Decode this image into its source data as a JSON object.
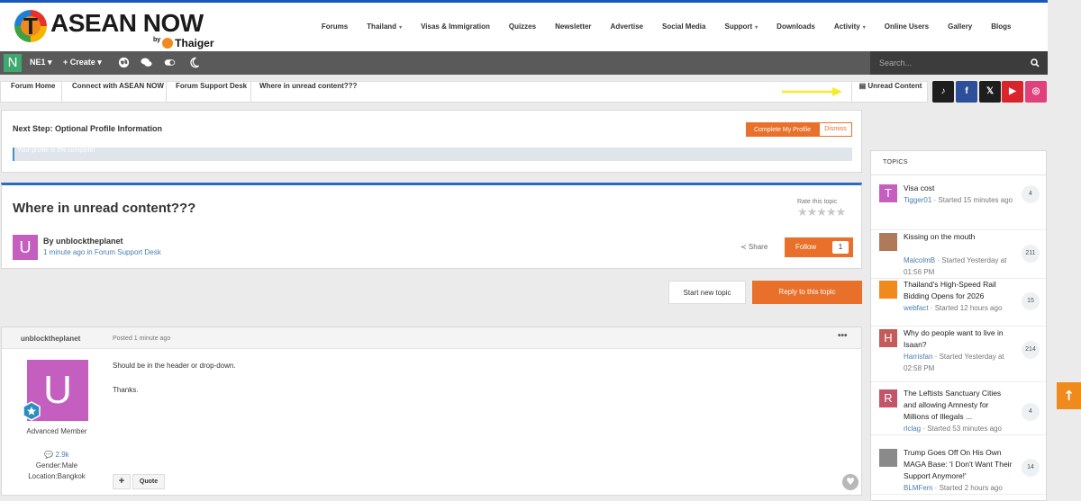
{
  "header": {
    "logo_text": "ASEAN NOW",
    "logo_by": "by",
    "logo_sub": "Thaiger",
    "nav": [
      {
        "label": "Forums",
        "caret": ""
      },
      {
        "label": "Thailand",
        "caret": "▾"
      },
      {
        "label": "Visas & Immigration",
        "caret": ""
      },
      {
        "label": "Quizzes",
        "caret": ""
      },
      {
        "label": "Newsletter",
        "caret": ""
      },
      {
        "label": "Advertise",
        "caret": ""
      },
      {
        "label": "Social Media",
        "caret": ""
      },
      {
        "label": "Support",
        "caret": "▾"
      },
      {
        "label": "Downloads",
        "caret": ""
      },
      {
        "label": "Activity",
        "caret": "▾"
      },
      {
        "label": "Online Users",
        "caret": ""
      },
      {
        "label": "Gallery",
        "caret": ""
      },
      {
        "label": "Blogs",
        "caret": ""
      }
    ]
  },
  "user_bar": {
    "avatar_letter": "N",
    "user_menu": "NE1 ▾",
    "create": "+ Create ▾",
    "search_placeholder": "Search..."
  },
  "breadcrumb": {
    "items": [
      "Forum Home",
      "Connect with ASEAN NOW",
      "Forum Support Desk",
      "Where in unread content???"
    ],
    "unread": "▤ Unread Content"
  },
  "social": [
    {
      "name": "tiktok",
      "glyph": "♪",
      "color": "#1e1e1e"
    },
    {
      "name": "facebook",
      "glyph": "f",
      "color": "#2d4f9a"
    },
    {
      "name": "x",
      "glyph": "𝕏",
      "color": "#1e1e1e"
    },
    {
      "name": "youtube",
      "glyph": "▶",
      "color": "#d8242a"
    },
    {
      "name": "instagram",
      "glyph": "◎",
      "color": "#e0407b"
    }
  ],
  "profile_step": {
    "title": "Next Step: Optional Profile Information",
    "complete_label": "Complete My Profile",
    "dismiss_label": "Dismiss",
    "progress_text": "Your profile is 0% complete!",
    "progress_percent": 0
  },
  "topic": {
    "title": "Where in unread content???",
    "rate_label": "Rate this topic",
    "stars": "★★★★★",
    "author_letter": "U",
    "by_text": "By unblocktheplanet",
    "meta": "1 minute ago in Forum Support Desk",
    "share": "≺ Share",
    "follow": "Follow",
    "follow_count": "1"
  },
  "actions": {
    "start_topic": "Start new topic",
    "reply": "Reply to this topic"
  },
  "post": {
    "author": "unblocktheplanet",
    "time": "Posted 1 minute ago",
    "menu": "•••",
    "avatar_letter": "U",
    "rank": "Advanced Member",
    "reputation": "💬 2.9k",
    "gender": "Gender:Male",
    "location": "Location:Bangkok",
    "body_line1": "Should be in the header or drop-down.",
    "body_line2": "Thanks.",
    "plus": "+",
    "quote": "Quote",
    "like": "♥"
  },
  "sidebar": {
    "title": "TOPICS",
    "topics": [
      {
        "title": "Visa cost",
        "user": "Tigger01",
        "meta": " · Started 15 minutes ago",
        "count": "4",
        "avatar": "T",
        "color": "#c45fc0"
      },
      {
        "title": "Kissing on the mouth",
        "user": "MalcolmB",
        "meta": " · Started Yesterday at 01:56 PM",
        "count": "211",
        "avatar": "",
        "color": "#b07a5a"
      },
      {
        "title": "Thailand's High-Speed Rail Bidding Opens for 2026",
        "user": "webfact",
        "meta": " · Started 12 hours ago",
        "count": "15",
        "avatar": "",
        "color": "#f08a1c"
      },
      {
        "title": "Why do people want to live in Isaan?",
        "user": "Harrisfan",
        "meta": " · Started Yesterday at 02:58 PM",
        "count": "214",
        "avatar": "H",
        "color": "#c45a5a"
      },
      {
        "title": "The Leftists Sanctuary Cities and allowing Amnesty for Millions of Illegals ...",
        "user": "rlclag",
        "meta": " · Started 53 minutes ago",
        "count": "4",
        "avatar": "R",
        "color": "#c4546a"
      },
      {
        "title": "Trump Goes Off On His Own MAGA Base: 'I Don't Want Their Support Anymore!'",
        "user": "BLMFem",
        "meta": " · Started 2 hours ago",
        "count": "14",
        "avatar": "",
        "color": "#8a8a8a"
      }
    ]
  },
  "scroll_top": "↑"
}
